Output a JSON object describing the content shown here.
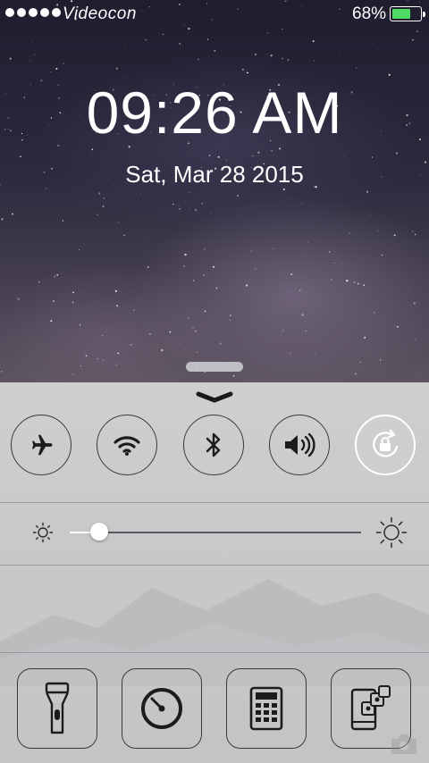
{
  "status_bar": {
    "carrier": "Videocon",
    "signal_bars": 5,
    "battery_percent": "68%",
    "battery_level": 0.68,
    "battery_color": "#4cd964"
  },
  "lock_screen": {
    "time": "09:26 AM",
    "date": "Sat, Mar 28 2015"
  },
  "control_center": {
    "toggles": [
      {
        "icon": "airplane-icon",
        "state": "off"
      },
      {
        "icon": "wifi-icon",
        "state": "off"
      },
      {
        "icon": "bluetooth-icon",
        "state": "off"
      },
      {
        "icon": "volume-icon",
        "state": "off"
      },
      {
        "icon": "rotation-lock-icon",
        "state": "on"
      }
    ],
    "brightness": {
      "level": 0.1,
      "min_icon": "sun-small-icon",
      "max_icon": "sun-large-icon"
    },
    "tools": [
      {
        "icon": "flashlight-icon"
      },
      {
        "icon": "timer-icon"
      },
      {
        "icon": "calculator-icon"
      },
      {
        "icon": "app-switcher-icon"
      }
    ],
    "corner_icon": "camera-icon"
  }
}
